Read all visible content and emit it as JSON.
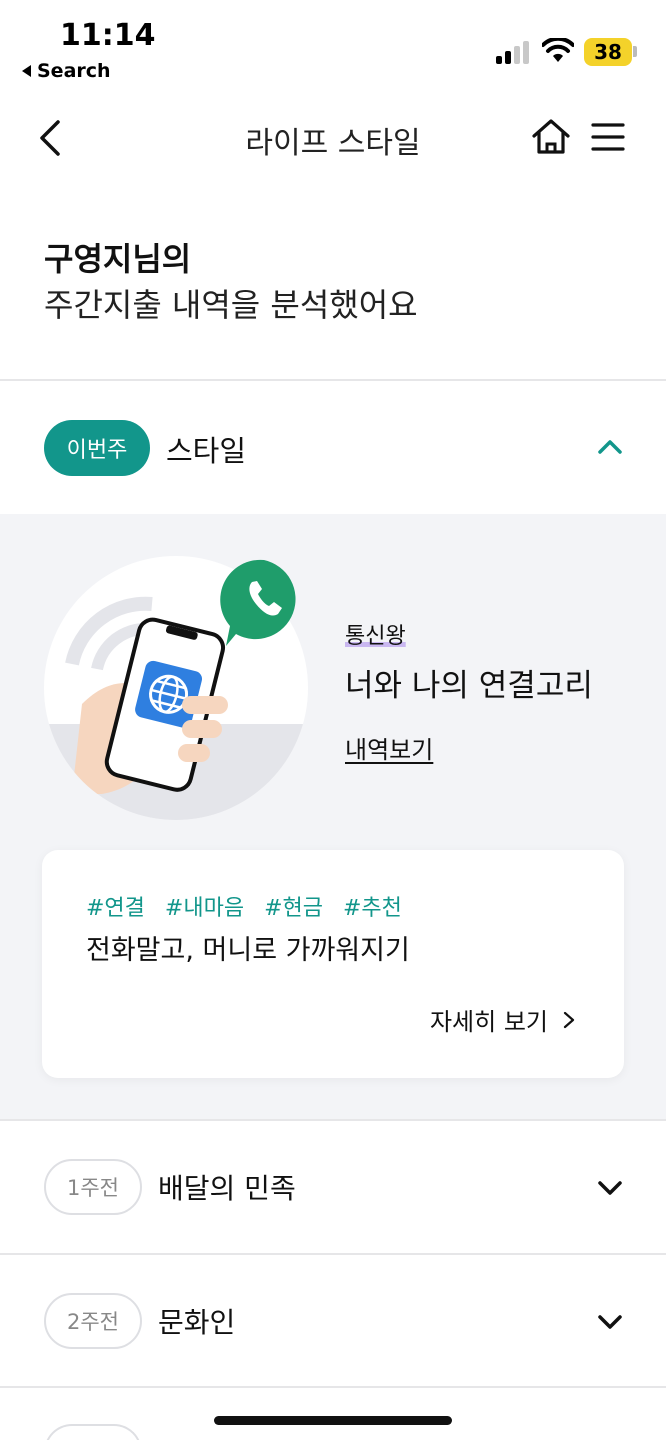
{
  "status_bar": {
    "time": "11:14",
    "back_label": "Search",
    "battery": "38"
  },
  "nav": {
    "title": "라이프 스타일"
  },
  "heading": {
    "name": "구영지님의",
    "subtitle": "주간지출 내역을 분석했어요"
  },
  "current_week": {
    "badge": "이번주",
    "title": "스타일",
    "style_subtitle": "통신왕",
    "style_title": "너와 나의 연결고리",
    "history_link": "내역보기",
    "card": {
      "tags": [
        "#연결",
        "#내마음",
        "#현금",
        "#추천"
      ],
      "title": "전화말고, 머니로 가까워지기",
      "more_label": "자세히 보기"
    }
  },
  "past_weeks": [
    {
      "badge": "1주전",
      "title": "배달의 민족"
    },
    {
      "badge": "2주전",
      "title": "문화인"
    }
  ],
  "colors": {
    "accent": "#12968b",
    "panel_bg": "#f3f4f7",
    "highlight": "#c9b7f0",
    "phone_bubble": "#1f9d6b",
    "globe_blue": "#2f7fe0"
  }
}
